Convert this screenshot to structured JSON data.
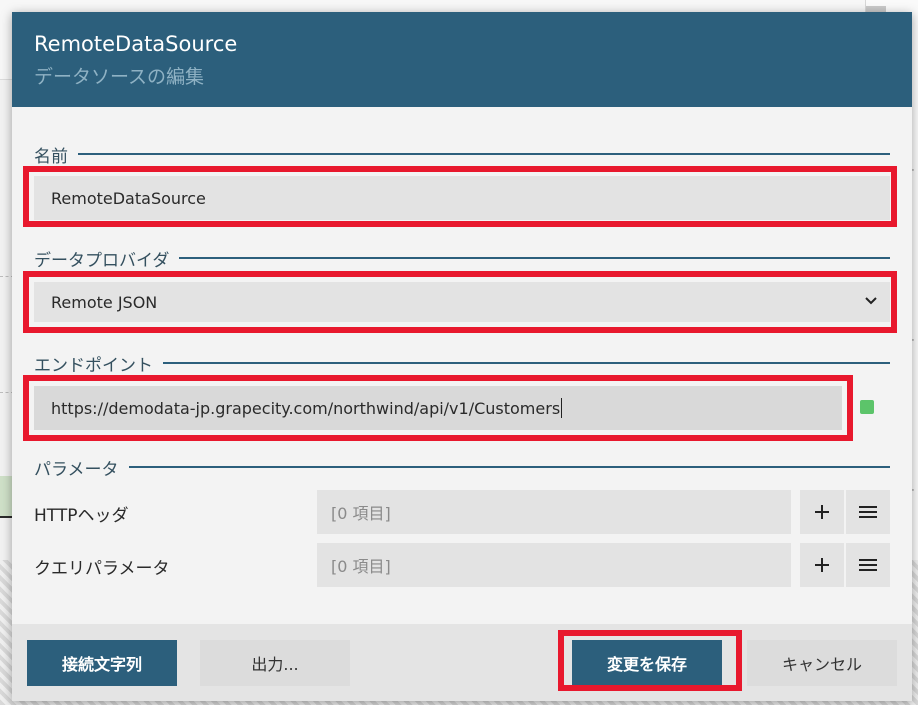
{
  "dialog": {
    "title": "RemoteDataSource",
    "subtitle": "データソースの編集"
  },
  "name_section": {
    "label": "名前",
    "value": "RemoteDataSource"
  },
  "provider_section": {
    "label": "データプロバイダ",
    "selected": "Remote JSON"
  },
  "endpoint_section": {
    "label": "エンドポイント",
    "value": "https://demodata-jp.grapecity.com/northwind/api/v1/Customers",
    "status_color": "#5cc46a"
  },
  "params_section": {
    "label": "パラメータ",
    "rows": [
      {
        "label": "HTTPヘッダ",
        "value": "[0 項目]"
      },
      {
        "label": "クエリパラメータ",
        "value": "[0 項目]"
      }
    ]
  },
  "footer": {
    "connection_string_label": "接続文字列",
    "output_label": "出力...",
    "save_label": "変更を保存",
    "cancel_label": "キャンセル"
  },
  "icons": {
    "add": "plus-icon",
    "menu": "hamburger-icon",
    "dropdown": "chevron-down-icon"
  },
  "colors": {
    "header": "#2c5f7c",
    "highlight": "#e8182d",
    "primary_button": "#2c5f7c"
  }
}
